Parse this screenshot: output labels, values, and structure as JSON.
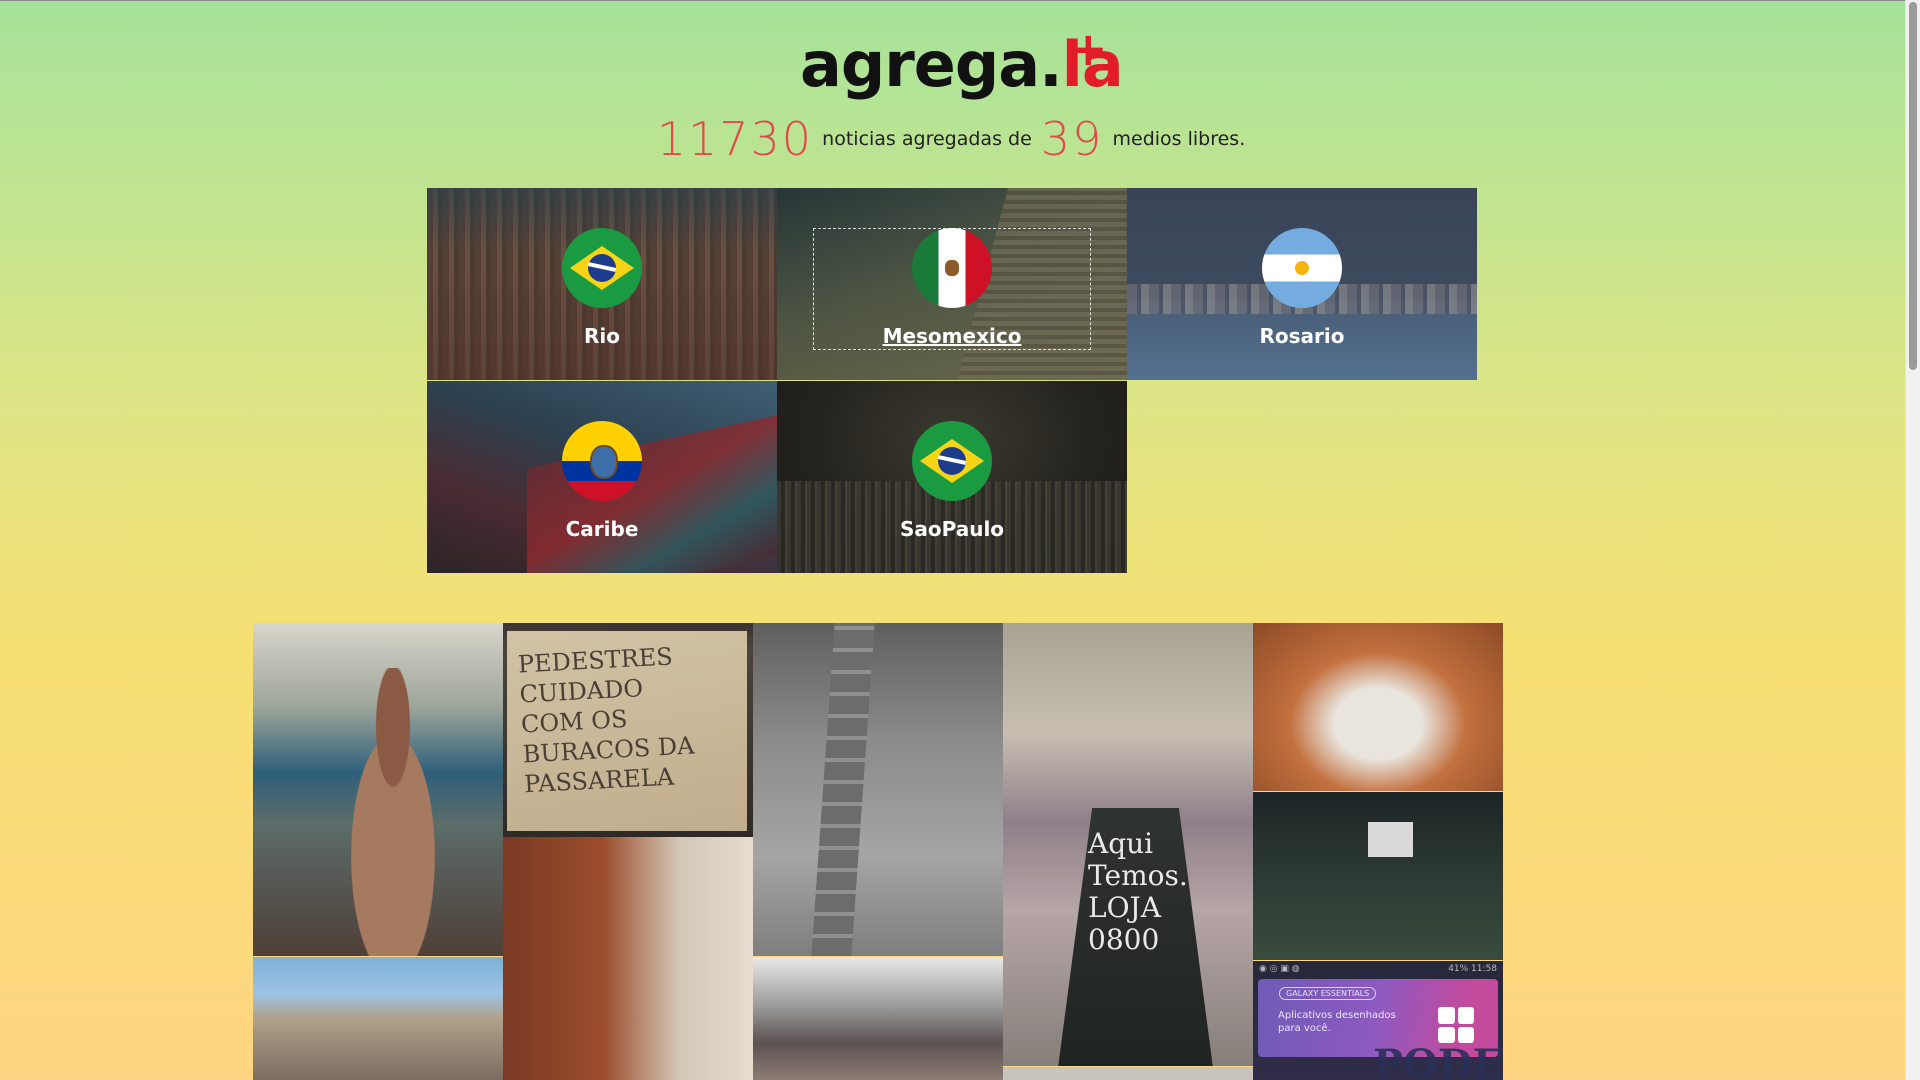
{
  "logo": {
    "brand": "agrega.",
    "accent": "la",
    "plus": "+"
  },
  "stats": {
    "news_count": "11730",
    "text_before": "noticias agregadas de",
    "media_count": "39",
    "text_after": "medios libres."
  },
  "regions": [
    {
      "label": "Rio",
      "flag": "brazil-flag-icon",
      "active": false
    },
    {
      "label": "Mesomexico",
      "flag": "mexico-flag-icon",
      "active": true
    },
    {
      "label": "Rosario",
      "flag": "argentina-flag-icon",
      "active": false
    },
    {
      "label": "Caribe",
      "flag": "ecuador-flag-icon",
      "active": false
    },
    {
      "label": "SaoPaulo",
      "flag": "brazil-flag-icon",
      "active": false
    }
  ],
  "photos": {
    "sign_text": "PEDESTRES\nCUIDADO\nCOM OS\nBURACOS DA\nPASSARELA",
    "board_text": "Aqui\nTemos...\nLOJA\n0800",
    "phone_status_left": "◉ ◎ ▣ ◍",
    "phone_status_right": "41% 11:58",
    "phone_pill": "GALAXY ESSENTIALS",
    "phone_desc": "Aplicativos desenhados para você.",
    "phone_overlay": "PODER"
  },
  "colors": {
    "accent_red": "#e21d2a",
    "count_red": "#e04a4a",
    "bg_top": "#a6e39a",
    "bg_bottom": "#ffd583"
  }
}
